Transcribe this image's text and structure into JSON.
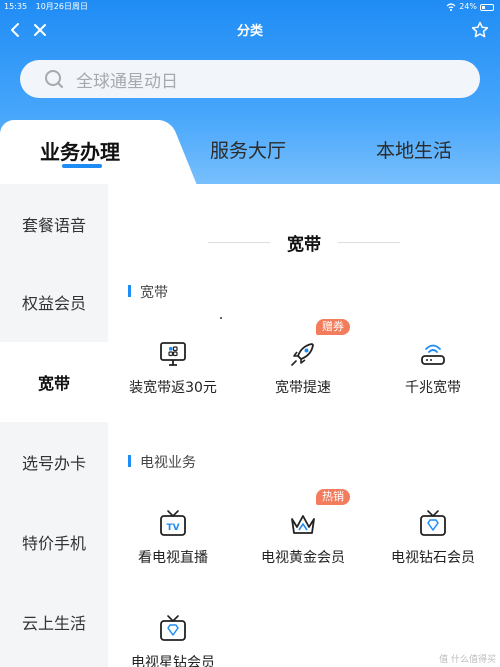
{
  "status_bar": {
    "time": "15:35",
    "date": "10月26日周日",
    "battery": "24%"
  },
  "nav": {
    "title": "分类",
    "icons": [
      "chevron-left-icon",
      "close-icon",
      "star-icon"
    ]
  },
  "search": {
    "placeholder": "全球通星动日"
  },
  "tabs": [
    {
      "label": "业务办理",
      "active": true
    },
    {
      "label": "服务大厅",
      "active": false
    },
    {
      "label": "本地生活",
      "active": false
    }
  ],
  "sidebar": {
    "items": [
      {
        "label": "套餐语音",
        "active": false
      },
      {
        "label": "权益会员",
        "active": false
      },
      {
        "label": "宽带",
        "active": true
      },
      {
        "label": "选号办卡",
        "active": false
      },
      {
        "label": "特价手机",
        "active": false
      },
      {
        "label": "云上生活",
        "active": false
      }
    ]
  },
  "content": {
    "section_title": "宽带",
    "categories": [
      {
        "label": "宽带",
        "items": [
          {
            "label": "装宽带返30元",
            "icon": "monitor-icon",
            "badge": ""
          },
          {
            "label": "宽带提速",
            "icon": "rocket-icon",
            "badge": "赠券"
          },
          {
            "label": "千兆宽带",
            "icon": "router-icon",
            "badge": ""
          }
        ]
      },
      {
        "label": "电视业务",
        "items": [
          {
            "label": "看电视直播",
            "icon": "tv-icon",
            "badge": ""
          },
          {
            "label": "电视黄金会员",
            "icon": "crown-icon",
            "badge": "热销"
          },
          {
            "label": "电视钻石会员",
            "icon": "tv-diamond-icon",
            "badge": ""
          },
          {
            "label": "电视星钻会员",
            "icon": "tv-diamond-icon",
            "badge": ""
          }
        ]
      }
    ]
  },
  "colors": {
    "accent": "#1f8cf5",
    "badge": "#f27c5c",
    "icon_blue": "#1f8cf5"
  },
  "watermark": "值 什么值得买"
}
